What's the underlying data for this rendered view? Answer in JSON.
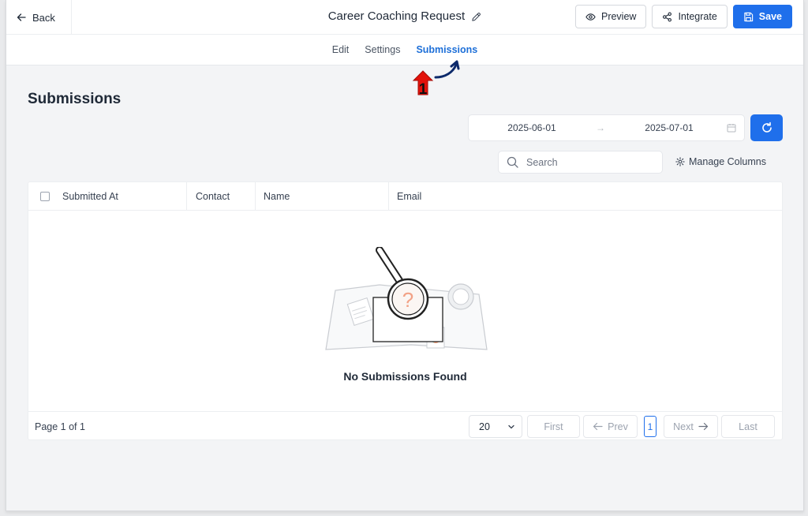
{
  "header": {
    "back_label": "Back",
    "form_title": "Career Coaching Request",
    "preview_label": "Preview",
    "integrate_label": "Integrate",
    "save_label": "Save"
  },
  "tabs": [
    {
      "label": "Edit",
      "active": false
    },
    {
      "label": "Settings",
      "active": false
    },
    {
      "label": "Submissions",
      "active": true
    }
  ],
  "annotation": {
    "number": "1"
  },
  "page": {
    "title": "Submissions",
    "date_start": "2025-06-01",
    "date_end": "2025-07-01",
    "search_placeholder": "Search",
    "manage_columns_label": "Manage Columns"
  },
  "table": {
    "columns": [
      "Submitted At",
      "Contact",
      "Name",
      "Email"
    ],
    "empty_text": "No Submissions Found"
  },
  "pagination": {
    "page_info": "Page 1 of 1",
    "page_size": "20",
    "first_label": "First",
    "prev_label": "Prev",
    "current_page": "1",
    "next_label": "Next",
    "last_label": "Last"
  },
  "colors": {
    "accent": "#1f6feb",
    "active_tab": "#1d6fd8",
    "annotation_red": "#e3120b",
    "annotation_arrow": "#0d2a6b"
  }
}
